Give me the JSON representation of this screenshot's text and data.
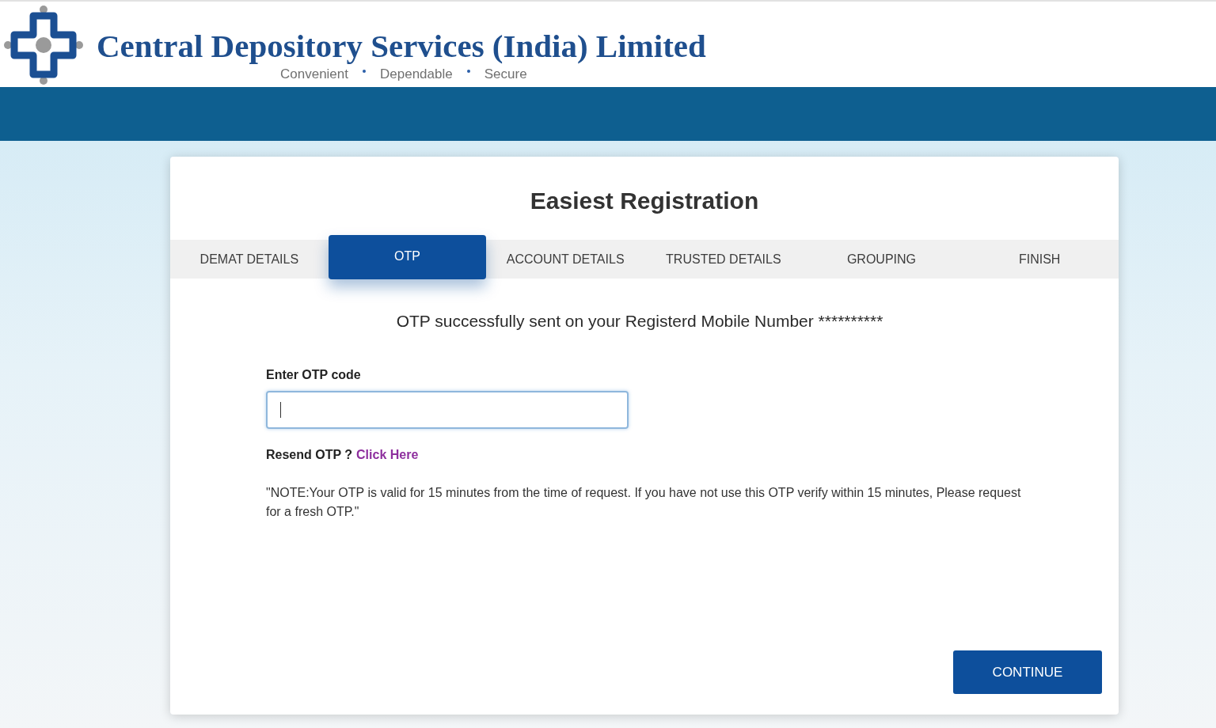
{
  "header": {
    "company_name": "Central Depository Services (India) Limited",
    "tagline": [
      "Convenient",
      "Dependable",
      "Secure"
    ]
  },
  "registration": {
    "title": "Easiest Registration",
    "tabs": [
      {
        "label": "DEMAT DETAILS",
        "selected": false
      },
      {
        "label": "OTP",
        "selected": true
      },
      {
        "label": "ACCOUNT DETAILS",
        "selected": false
      },
      {
        "label": "TRUSTED DETAILS",
        "selected": false
      },
      {
        "label": "GROUPING",
        "selected": false
      },
      {
        "label": "FINISH",
        "selected": false
      }
    ],
    "message": "OTP successfully sent on your Registerd Mobile Number **********",
    "otp_field": {
      "label": "Enter OTP code",
      "focused": true
    },
    "resend": {
      "prompt": "Resend OTP ?",
      "link": "Click Here"
    },
    "note": "\"NOTE:Your OTP is valid for 15 minutes from the time of request. If you have not use this OTP verify within 15 minutes, Please request for a fresh OTP.\"",
    "continue_button": "CONTINUE"
  }
}
